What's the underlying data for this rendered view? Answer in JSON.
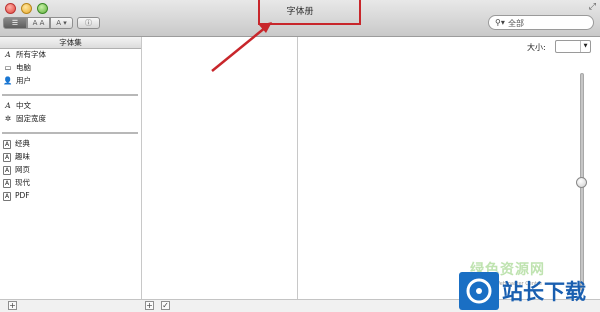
{
  "window": {
    "title": "字体册"
  },
  "toolbar": {
    "view_buttons": [
      "☰",
      "A A",
      "A",
      "i"
    ]
  },
  "search": {
    "placeholder": "全部",
    "icon": "search-icon"
  },
  "collections": {
    "header": "字体集",
    "group1": [
      {
        "label": "所有字体",
        "icon": "font-icon"
      },
      {
        "label": "电脑",
        "icon": "computer-icon"
      },
      {
        "label": "用户",
        "icon": "user-icon"
      }
    ],
    "group2": [
      {
        "label": "中文",
        "icon": "font-icon"
      },
      {
        "label": "固定宽度",
        "icon": "gear-icon"
      }
    ],
    "group3": [
      {
        "label": "经典",
        "icon": "collection-icon"
      },
      {
        "label": "趣味",
        "icon": "collection-icon"
      },
      {
        "label": "网页",
        "icon": "collection-icon"
      },
      {
        "label": "现代",
        "icon": "collection-icon"
      },
      {
        "label": "PDF",
        "icon": "collection-icon"
      }
    ]
  },
  "preview": {
    "size_label": "大小:",
    "size_value": "",
    "slider_fraction": 0.5
  },
  "bottom_bar": {
    "add": "+",
    "add_font": "+",
    "check": "✓"
  },
  "watermark": {
    "brand": "站长下载",
    "site_line": "绿色资源网",
    "url": "Easck.Com Webmaster Centre"
  }
}
